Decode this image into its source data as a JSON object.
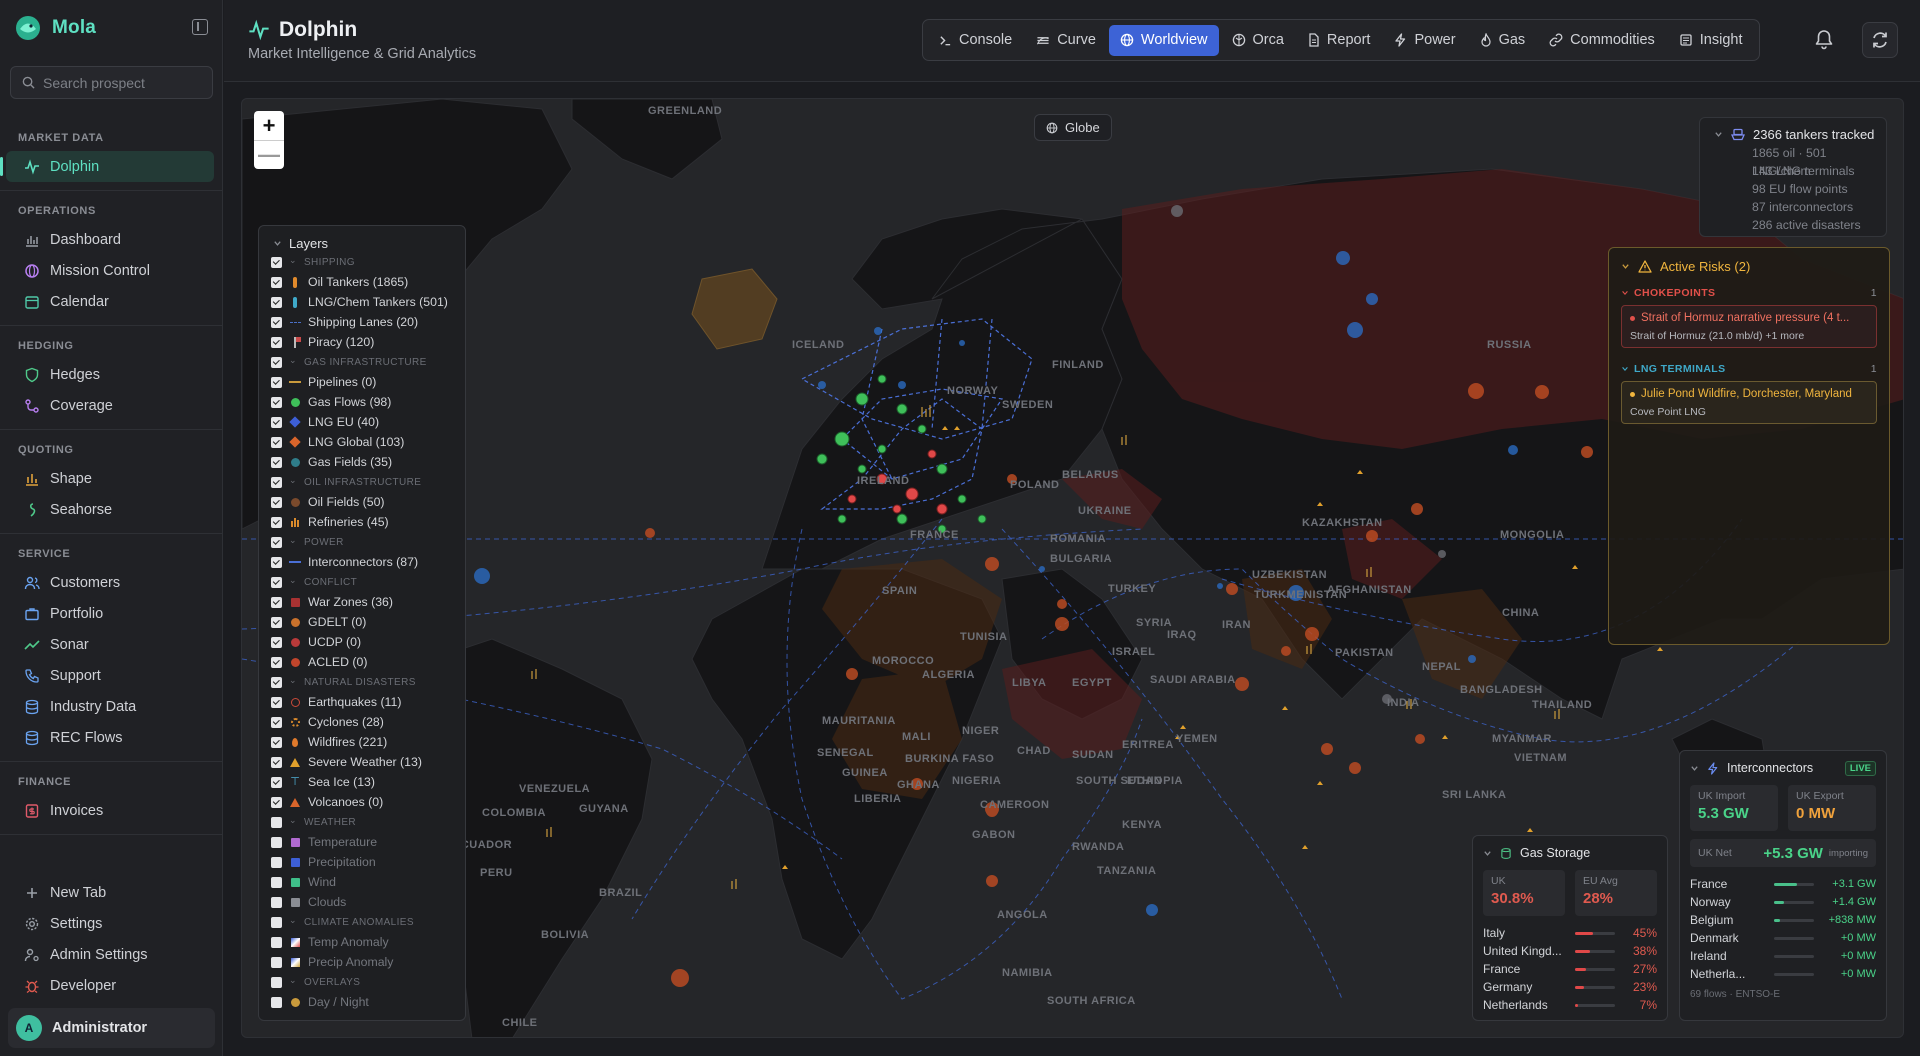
{
  "app": {
    "name": "Mola"
  },
  "search": {
    "placeholder": "Search prospect"
  },
  "nav": {
    "market_data": {
      "title": "MARKET DATA",
      "items": [
        "Dolphin"
      ]
    },
    "operations": {
      "title": "OPERATIONS",
      "items": [
        "Dashboard",
        "Mission Control",
        "Calendar"
      ]
    },
    "hedging": {
      "title": "HEDGING",
      "items": [
        "Hedges",
        "Coverage"
      ]
    },
    "quoting": {
      "title": "QUOTING",
      "items": [
        "Shape",
        "Seahorse"
      ]
    },
    "service": {
      "title": "SERVICE",
      "items": [
        "Customers",
        "Portfolio",
        "Sonar",
        "Support",
        "Industry Data",
        "REC Flows"
      ]
    },
    "finance": {
      "title": "FINANCE",
      "items": [
        "Invoices"
      ]
    },
    "bottom": [
      "New Tab",
      "Settings",
      "Admin Settings",
      "Developer"
    ],
    "user": {
      "initial": "A",
      "name": "Administrator"
    }
  },
  "header": {
    "title": "Dolphin",
    "subtitle": "Market Intelligence & Grid Analytics",
    "tabs": [
      "Console",
      "Curve",
      "Worldview",
      "Orca",
      "Report",
      "Power",
      "Gas",
      "Commodities",
      "Insight"
    ],
    "active_tab": "Worldview"
  },
  "map": {
    "globe_label": "Globe",
    "zoom_in": "+",
    "zoom_out": "—",
    "labels": [
      "GREENLAND",
      "ICELAND",
      "FINLAND",
      "NORWAY",
      "SWEDEN",
      "RUSSIA",
      "KAZAKHSTAN",
      "MONGOLIA",
      "UZBEKISTAN",
      "TURKMENISTAN",
      "AFGHANISTAN",
      "CHINA",
      "IRAN",
      "PAKISTAN",
      "NEPAL",
      "INDIA",
      "BANGLADESH",
      "MYANMAR",
      "VIETNAM",
      "TURKEY",
      "SYRIA",
      "IRAQ",
      "ISRAEL",
      "SAUDI ARABIA",
      "YEMEN",
      "EGYPT",
      "LIBYA",
      "ALGERIA",
      "TUNISIA",
      "MOROCCO",
      "MAURITANIA",
      "MALI",
      "NIGER",
      "CHAD",
      "SUDAN",
      "ETHIOPIA",
      "ERITREA",
      "NIGERIA",
      "SENEGAL",
      "GUINEA",
      "LIBERIA",
      "BURKINA FASO",
      "GHANA",
      "CAMEROON",
      "GABON",
      "SOUTH SUDAN",
      "KENYA",
      "RWANDA",
      "TANZANIA",
      "ANGOLA",
      "NAMIBIA",
      "SOUTH AFRICA",
      "UKRAINE",
      "BELARUS",
      "POLAND",
      "ROMANIA",
      "BULGARIA",
      "FRANCE",
      "SPAIN",
      "IRELAND",
      "VENEZUELA",
      "GUYANA",
      "COLOMBIA",
      "PERU",
      "BRAZIL",
      "BOLIVIA",
      "CHILE",
      "ECUADOR",
      "SRI LANKA",
      "THAILAND"
    ]
  },
  "layers": {
    "title": "Layers",
    "rows": [
      {
        "t": "sec",
        "label": "SHIPPING",
        "checked": true
      },
      {
        "t": "item",
        "label": "Oil Tankers (1865)",
        "checked": true,
        "icon": "oil-tanker-icon",
        "color": "#e08a2c"
      },
      {
        "t": "item",
        "label": "LNG/Chem Tankers (501)",
        "checked": true,
        "icon": "lng-tanker-icon",
        "color": "#3fa9c9"
      },
      {
        "t": "item",
        "label": "Shipping Lanes (20)",
        "checked": true,
        "icon": "shipping-lane-icon",
        "color": "#4a70c9"
      },
      {
        "t": "item",
        "label": "Piracy (120)",
        "checked": true,
        "icon": "pirate-flag-icon",
        "color": "#c84a4a"
      },
      {
        "t": "sec",
        "label": "GAS INFRASTRUCTURE",
        "checked": true
      },
      {
        "t": "item",
        "label": "Pipelines (0)",
        "checked": true,
        "icon": "pipeline-icon",
        "color": "#c99a3c"
      },
      {
        "t": "item",
        "label": "Gas Flows (98)",
        "checked": true,
        "icon": "dot-icon",
        "color": "#3fbf5a"
      },
      {
        "t": "item",
        "label": "LNG EU (40)",
        "checked": true,
        "icon": "diamond-icon",
        "color": "#3d5fd6"
      },
      {
        "t": "item",
        "label": "LNG Global (103)",
        "checked": true,
        "icon": "diamond-icon",
        "color": "#d9652b"
      },
      {
        "t": "item",
        "label": "Gas Fields (35)",
        "checked": true,
        "icon": "dot-icon",
        "color": "#2f7d8a"
      },
      {
        "t": "sec",
        "label": "OIL INFRASTRUCTURE",
        "checked": true
      },
      {
        "t": "item",
        "label": "Oil Fields (50)",
        "checked": true,
        "icon": "dot-icon",
        "color": "#7a4a2c"
      },
      {
        "t": "item",
        "label": "Refineries (45)",
        "checked": true,
        "icon": "refinery-icon",
        "color": "#d98a2c"
      },
      {
        "t": "sec",
        "label": "POWER",
        "checked": true
      },
      {
        "t": "item",
        "label": "Interconnectors (87)",
        "checked": true,
        "icon": "interconnector-line-icon",
        "color": "#4a6fd6"
      },
      {
        "t": "sec",
        "label": "CONFLICT",
        "checked": true
      },
      {
        "t": "item",
        "label": "War Zones (36)",
        "checked": true,
        "icon": "square-icon",
        "color": "#a83232"
      },
      {
        "t": "item",
        "label": "GDELT (0)",
        "checked": true,
        "icon": "dot-icon",
        "color": "#c9712c"
      },
      {
        "t": "item",
        "label": "UCDP (0)",
        "checked": true,
        "icon": "dot-icon",
        "color": "#b83a3a"
      },
      {
        "t": "item",
        "label": "ACLED (0)",
        "checked": true,
        "icon": "dot-icon",
        "color": "#c0452c"
      },
      {
        "t": "sec",
        "label": "NATURAL DISASTERS",
        "checked": true
      },
      {
        "t": "item",
        "label": "Earthquakes (11)",
        "checked": true,
        "icon": "earthquake-icon",
        "color": "#c84a3a"
      },
      {
        "t": "item",
        "label": "Cyclones (28)",
        "checked": true,
        "icon": "cyclone-icon",
        "color": "#d98a2c"
      },
      {
        "t": "item",
        "label": "Wildfires (221)",
        "checked": true,
        "icon": "flame-icon",
        "color": "#e07a2c"
      },
      {
        "t": "item",
        "label": "Severe Weather (13)",
        "checked": true,
        "icon": "warning-triangle-icon",
        "color": "#e0a02c"
      },
      {
        "t": "item",
        "label": "Sea Ice (13)",
        "checked": true,
        "icon": "sea-ice-icon",
        "color": "#4fb0d6"
      },
      {
        "t": "item",
        "label": "Volcanoes (0)",
        "checked": true,
        "icon": "volcano-icon",
        "color": "#d9652b"
      },
      {
        "t": "sec",
        "label": "WEATHER",
        "checked": false
      },
      {
        "t": "item",
        "label": "Temperature",
        "checked": false,
        "icon": "square-icon",
        "color": "#b06ad0"
      },
      {
        "t": "item",
        "label": "Precipitation",
        "checked": false,
        "icon": "square-icon",
        "color": "#3d5fd6"
      },
      {
        "t": "item",
        "label": "Wind",
        "checked": false,
        "icon": "square-icon",
        "color": "#3fbf8a"
      },
      {
        "t": "item",
        "label": "Clouds",
        "checked": false,
        "icon": "square-icon",
        "color": "#8a8d94"
      },
      {
        "t": "sec",
        "label": "CLIMATE ANOMALIES",
        "checked": false
      },
      {
        "t": "item",
        "label": "Temp Anomaly",
        "checked": false,
        "icon": "gradient-square-icon",
        "color": "#d94a4a"
      },
      {
        "t": "item",
        "label": "Precip Anomaly",
        "checked": false,
        "icon": "gradient-square-icon",
        "color": "#c9a03c"
      },
      {
        "t": "sec",
        "label": "OVERLAYS",
        "checked": false
      },
      {
        "t": "item",
        "label": "Day / Night",
        "checked": false,
        "icon": "dot-icon",
        "color": "#c99a3c"
      }
    ]
  },
  "stats": {
    "title": "2366 tankers tracked",
    "lines": [
      "1865 oil · 501 LNG/chem",
      "143 LNG terminals",
      "98 EU flow points",
      "87 interconnectors",
      "286 active disasters"
    ]
  },
  "risks": {
    "title": "Active Risks (2)",
    "sections": [
      {
        "name": "CHOKEPOINTS",
        "count": "1",
        "color": "#e0504a",
        "card": {
          "title": "Strait of Hormuz narrative pressure (4 t...",
          "sub": "Strait of Hormuz (21.0 mb/d) +1 more",
          "style": "red"
        }
      },
      {
        "name": "LNG TERMINALS",
        "count": "1",
        "color": "#3fa9c9",
        "card": {
          "title": "Julie Pond Wildfire, Dorchester, Maryland",
          "sub": "Cove Point LNG",
          "style": "amber"
        }
      }
    ]
  },
  "gas_storage": {
    "title": "Gas Storage",
    "uk_label": "UK",
    "uk_value": "30.8%",
    "eu_label": "EU Avg",
    "eu_value": "28%",
    "rows": [
      {
        "name": "Italy",
        "pct": "45%",
        "v": 0.45
      },
      {
        "name": "United Kingd...",
        "pct": "38%",
        "v": 0.38
      },
      {
        "name": "France",
        "pct": "27%",
        "v": 0.27
      },
      {
        "name": "Germany",
        "pct": "23%",
        "v": 0.23
      },
      {
        "name": "Netherlands",
        "pct": "7%",
        "v": 0.07
      }
    ]
  },
  "interconnectors": {
    "title": "Interconnectors",
    "live": "LIVE",
    "import_label": "UK Import",
    "import_value": "5.3 GW",
    "export_label": "UK Export",
    "export_value": "0 MW",
    "net_label": "UK Net",
    "net_value": "+5.3 GW",
    "net_state": "importing",
    "rows": [
      {
        "name": "France",
        "value": "+3.1 GW",
        "v": 0.58
      },
      {
        "name": "Norway",
        "value": "+1.4 GW",
        "v": 0.26
      },
      {
        "name": "Belgium",
        "value": "+838 MW",
        "v": 0.16
      },
      {
        "name": "Denmark",
        "value": "+0 MW",
        "v": 0
      },
      {
        "name": "Ireland",
        "value": "+0 MW",
        "v": 0
      },
      {
        "name": "Netherla...",
        "value": "+0 MW",
        "v": 0
      }
    ],
    "footer": "69 flows · ENTSO-E"
  }
}
